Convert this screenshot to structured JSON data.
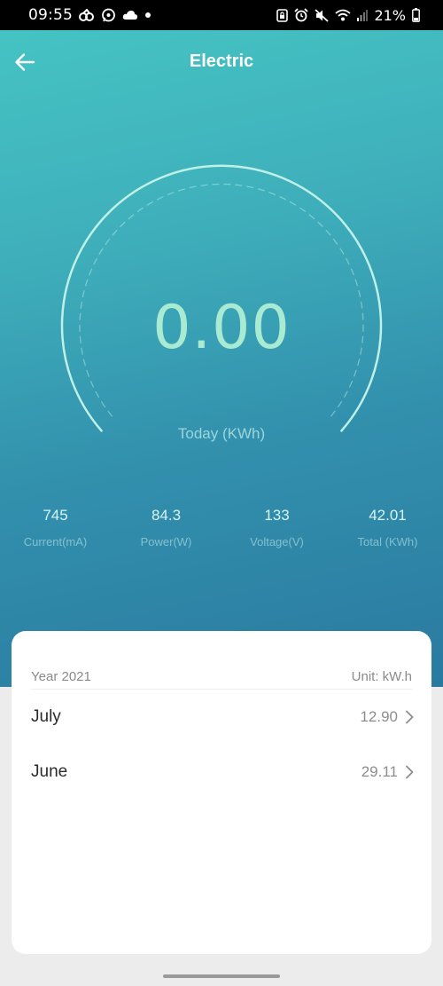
{
  "status_bar": {
    "time": "09:55",
    "battery": "21%",
    "left_icons": [
      "activity-icon",
      "whatsapp-icon",
      "cloud-icon",
      "dot-icon"
    ],
    "right_icons": [
      "lock-screen-icon",
      "alarm-icon",
      "mute-icon",
      "wifi-icon",
      "signal-icon",
      "battery-icon"
    ]
  },
  "header": {
    "title": "Electric",
    "back_icon": "arrow-left-icon"
  },
  "gauge": {
    "value": "0.00",
    "caption": "Today (KWh)"
  },
  "stats": [
    {
      "value": "745",
      "label": "Current(mA)"
    },
    {
      "value": "84.3",
      "label": "Power(W)"
    },
    {
      "value": "133",
      "label": "Voltage(V)"
    },
    {
      "value": "42.01",
      "label": "Total (KWh)"
    }
  ],
  "history": {
    "year_label": "Year 2021",
    "unit_label": "Unit: kW.h",
    "months": [
      {
        "name": "July",
        "value": "12.90"
      },
      {
        "name": "June",
        "value": "29.11"
      }
    ]
  },
  "colors": {
    "gradient_top": "#45c3c3",
    "gradient_bottom": "#2a7aa0",
    "gauge_accent": "#a8ead2"
  }
}
